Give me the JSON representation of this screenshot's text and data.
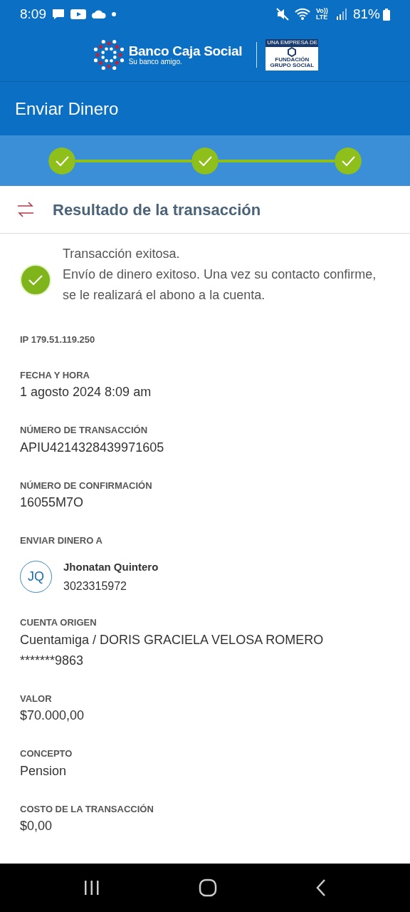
{
  "status_bar": {
    "time": "8:09",
    "battery": "81%",
    "network": "Vo)) LTE"
  },
  "brand": {
    "name": "Banco Caja Social",
    "tagline": "Su banco amigo.",
    "badge_top": "UNA EMPRESA DE",
    "badge_bottom": "FUNDACIÓN GRUPO SOCIAL"
  },
  "title": "Enviar Dinero",
  "steps": [
    {
      "completed": true
    },
    {
      "completed": true
    },
    {
      "completed": true
    }
  ],
  "section_title": "Resultado de la transacción",
  "result": {
    "success": true,
    "heading": "Transacción exitosa.",
    "message": "Envío de dinero exitoso. Una vez su contacto confirme, se le realizará el abono a la cuenta."
  },
  "fields": [
    {
      "kind": "note",
      "label": "IP 179.51.119.250"
    },
    {
      "kind": "text",
      "label": "FECHA Y HORA",
      "lines": [
        "1 agosto 2024 8:09 am"
      ]
    },
    {
      "kind": "text",
      "label": "NÚMERO DE TRANSACCIÓN",
      "lines": [
        "APIU4214328439971605"
      ]
    },
    {
      "kind": "text",
      "label": "NÚMERO DE CONFIRMACIÓN",
      "lines": [
        "16055M7O"
      ]
    },
    {
      "kind": "contact",
      "label": "ENVIAR DINERO A",
      "initials": "JQ",
      "name": "Jhonatan Quintero",
      "phone": "3023315972"
    },
    {
      "kind": "text",
      "label": "CUENTA ORIGEN",
      "lines": [
        "Cuentamiga / DORIS GRACIELA VELOSA ROMERO",
        "*******9863"
      ]
    },
    {
      "kind": "text",
      "label": "VALOR",
      "lines": [
        "$70.000,00"
      ]
    },
    {
      "kind": "text",
      "label": "CONCEPTO",
      "lines": [
        "Pension"
      ]
    },
    {
      "kind": "text",
      "label": "COSTO DE LA TRANSACCIÓN",
      "lines": [
        "$0,00"
      ]
    }
  ]
}
